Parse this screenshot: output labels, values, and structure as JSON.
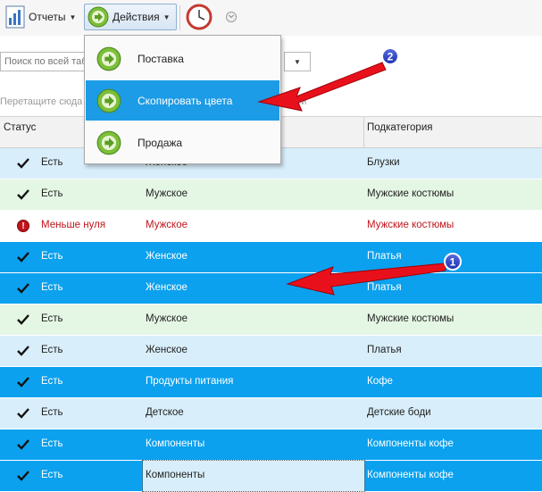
{
  "toolbar": {
    "reports_label": "Отчеты",
    "actions_label": "Действия"
  },
  "search": {
    "placeholder": "Поиск по всей табл"
  },
  "grouping": {
    "hint": "Перетащите сюда",
    "hint_tail": "ней"
  },
  "menu": {
    "items": [
      {
        "label": "Поставка"
      },
      {
        "label": "Скопировать цвета"
      },
      {
        "label": "Продажа"
      }
    ]
  },
  "table": {
    "columns": [
      "Статус",
      "Подкатегория"
    ],
    "rows": [
      {
        "status": "Есть",
        "category": "Женское",
        "subcategory": "Блузки",
        "icon": "check-icon"
      },
      {
        "status": "Есть",
        "category": "Мужское",
        "subcategory": "Мужские костюмы",
        "icon": "check-icon"
      },
      {
        "status": "Меньше нуля",
        "category": "Мужское",
        "subcategory": "Мужские костюмы",
        "icon": "error-icon"
      },
      {
        "status": "Есть",
        "category": "Женское",
        "subcategory": "Платья",
        "icon": "check-icon"
      },
      {
        "status": "Есть",
        "category": "Женское",
        "subcategory": "Платья",
        "icon": "check-icon"
      },
      {
        "status": "Есть",
        "category": "Мужское",
        "subcategory": "Мужские костюмы",
        "icon": "check-icon"
      },
      {
        "status": "Есть",
        "category": "Женское",
        "subcategory": "Платья",
        "icon": "check-icon"
      },
      {
        "status": "Есть",
        "category": "Продукты питания",
        "subcategory": "Кофе",
        "icon": "check-icon"
      },
      {
        "status": "Есть",
        "category": "Детское",
        "subcategory": "Детские боди",
        "icon": "check-icon"
      },
      {
        "status": "Есть",
        "category": "Компоненты",
        "subcategory": "Компоненты кофе",
        "icon": "check-icon"
      },
      {
        "status": "Есть",
        "category": "Компоненты",
        "subcategory": "Компоненты кофе",
        "icon": "check-icon"
      }
    ]
  },
  "callouts": [
    "1",
    "2"
  ],
  "colors": {
    "row_light_blue": "#d8eefb",
    "row_green": "#e4f6e4",
    "row_blue": "#0ba1ee",
    "row_white": "#ffffff",
    "error_red": "#c0151b",
    "menu_selected": "#1c9be6",
    "arrow_red": "#e8111b",
    "badge_blue": "#1a2fb0"
  }
}
